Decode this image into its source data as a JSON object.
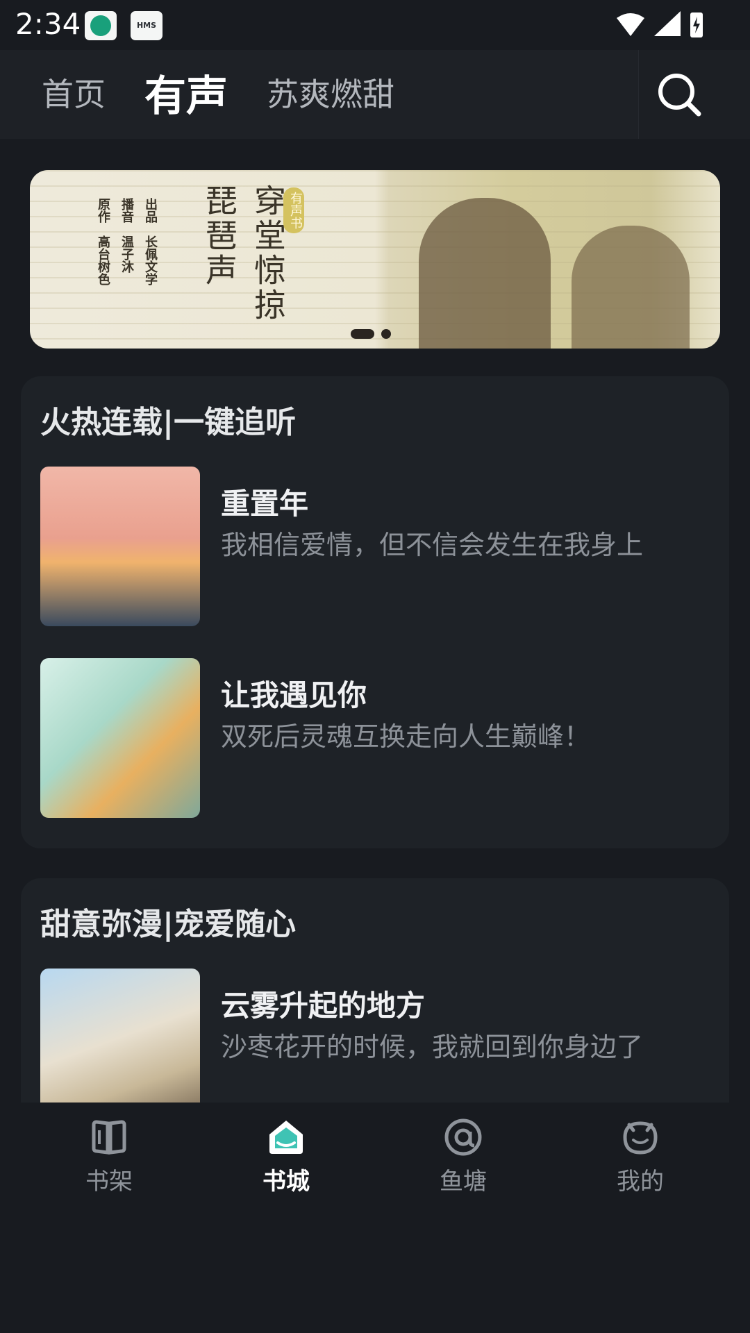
{
  "status_bar": {
    "time": "2:34",
    "app_badge_text": "HMS"
  },
  "top_tabs": [
    {
      "label": "首页",
      "active": false
    },
    {
      "label": "有声",
      "active": true
    },
    {
      "label": "苏爽燃甜",
      "active": false
    }
  ],
  "banner": {
    "title_line1": "琵琶声",
    "title_line2": "穿堂惊掠",
    "tag": "有声书",
    "credits": [
      {
        "label": "出品",
        "value": "长佩文学"
      },
      {
        "label": "播音",
        "value": "温子沐"
      },
      {
        "label": "原作",
        "value": "高台树色"
      }
    ],
    "page_count": 2,
    "current_page": 1
  },
  "sections": [
    {
      "title": "火热连载|一键追听",
      "books": [
        {
          "title": "重置年",
          "desc": "我相信爱情，但不信会发生在我身上"
        },
        {
          "title": "让我遇见你",
          "desc": "双死后灵魂互换走向人生巅峰！"
        }
      ]
    },
    {
      "title": "甜意弥漫|宠爱随心",
      "books": [
        {
          "title": "云雾升起的地方",
          "desc": "沙枣花开的时候，我就回到你身边了"
        }
      ]
    }
  ],
  "bottom_nav": [
    {
      "label": "书架",
      "icon": "bookshelf-icon",
      "active": false
    },
    {
      "label": "书城",
      "icon": "bookstore-home-icon",
      "active": true
    },
    {
      "label": "鱼塘",
      "icon": "at-sign-icon",
      "active": false
    },
    {
      "label": "我的",
      "icon": "profile-face-icon",
      "active": false
    }
  ],
  "colors": {
    "accent": "#3fc3b4",
    "background": "#181b20",
    "card": "#1e2227"
  }
}
